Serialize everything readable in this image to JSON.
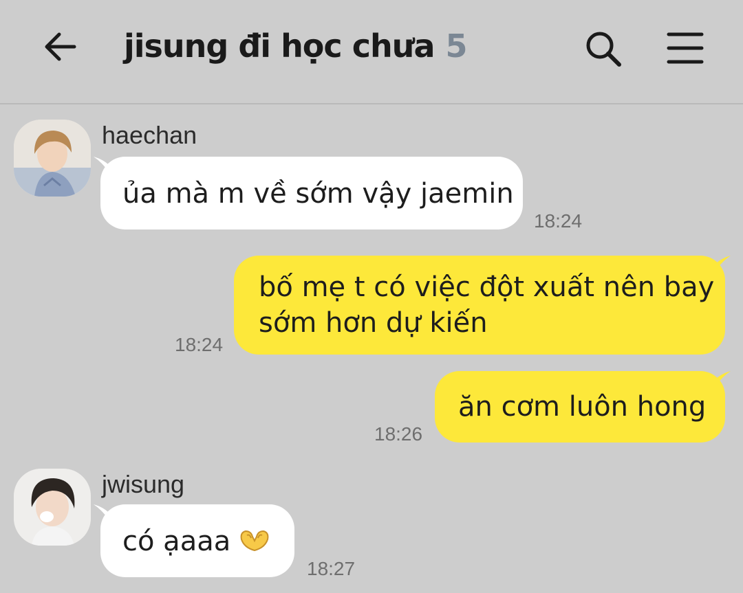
{
  "header": {
    "back_icon": "arrow-left",
    "title": "jisung đi học chưa",
    "member_count": "5",
    "search_icon": "search",
    "menu_icon": "hamburger-menu"
  },
  "messages": [
    {
      "sender": "haechan",
      "text": "ủa mà m về sớm vậy jaemin",
      "time": "18:24",
      "direction": "incoming"
    },
    {
      "text_line1": "bố mẹ t có việc đột xuất nên bay",
      "text_line2": "sớm hơn dự kiến",
      "time": "18:24",
      "direction": "outgoing"
    },
    {
      "text": "ăn cơm luôn hong",
      "time": "18:26",
      "direction": "outgoing"
    },
    {
      "sender": "jwisung",
      "text": "có ạaaa",
      "emoji": "heart-hands",
      "time": "18:27",
      "direction": "incoming"
    }
  ],
  "colors": {
    "background": "#cdcdcd",
    "incoming_bubble": "#ffffff",
    "outgoing_bubble": "#fde83a",
    "count_text": "#7b8794"
  }
}
